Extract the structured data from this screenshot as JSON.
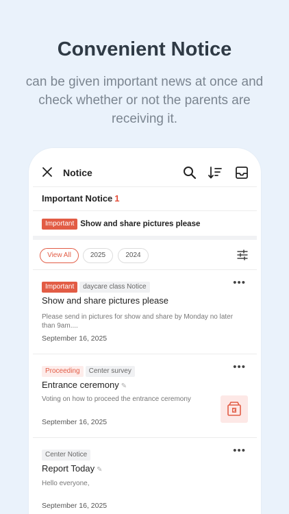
{
  "hero": {
    "title": "Convenient Notice",
    "subtitle": "can be given important news at once and check whether or not the parents are receiving it."
  },
  "appbar": {
    "title": "Notice"
  },
  "important": {
    "heading": "Important Notice",
    "count": "1",
    "badge": "Important",
    "text": "Show and share pictures please"
  },
  "filters": [
    "View All",
    "2025",
    "2024"
  ],
  "notices": [
    {
      "tags": [
        "Important",
        "daycare class Notice"
      ],
      "title": "Show and share pictures please",
      "body": "Please send in pictures for show and share by Monday no later than 9am....",
      "date": "September 16, 2025"
    },
    {
      "tags": [
        "Proceeding",
        "Center survey"
      ],
      "title": "Entrance ceremony",
      "body": "Voting on how to proceed the entrance ceremony",
      "date": "September 16, 2025"
    },
    {
      "tags": [
        "Center Notice"
      ],
      "title": "Report Today",
      "body": "Hello everyone,",
      "date": "September 16, 2025"
    }
  ],
  "colors": {
    "accent": "#e25c45",
    "background": "#eaf2fb"
  }
}
